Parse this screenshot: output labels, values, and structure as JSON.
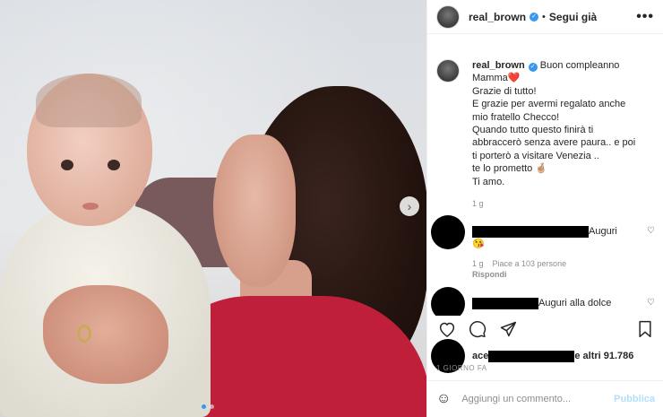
{
  "header": {
    "username": "real_brown",
    "separator": "•",
    "follow_label": "Segui già",
    "more_label": "•••"
  },
  "caption": {
    "username": "real_brown",
    "lines": [
      "Buon compleanno",
      "Mamma❤️",
      "Grazie di tutto!",
      "E grazie per avermi regalato anche",
      "mio fratello Checco!",
      "Quando tutto questo finirà ti",
      "abbraccerò senza avere paura.. e poi",
      "ti porterò a visitare Venezia ..",
      "te lo prometto 🤞🏼",
      "Ti amo."
    ],
    "time": "1 g"
  },
  "comments": [
    {
      "text": "Auguri",
      "emoji": "😘",
      "time": "1 g",
      "likes": "Piace a 103 persone",
      "reply": "Rispondi"
    },
    {
      "text": "Auguri alla dolce"
    }
  ],
  "likes": {
    "prefix": "ace",
    "suffix": "e altri 91.786"
  },
  "time_ago": "1 GIORNO FA",
  "add_comment": {
    "placeholder": "Aggiungi un commento...",
    "publish": "Pubblica"
  },
  "carousel": {
    "next_icon": "chevron-right-icon",
    "dot_count": 2,
    "active_index": 0
  },
  "colors": {
    "verified": "#3897f0",
    "publish_disabled": "#b2dffc",
    "muted": "#8e8e8e"
  }
}
